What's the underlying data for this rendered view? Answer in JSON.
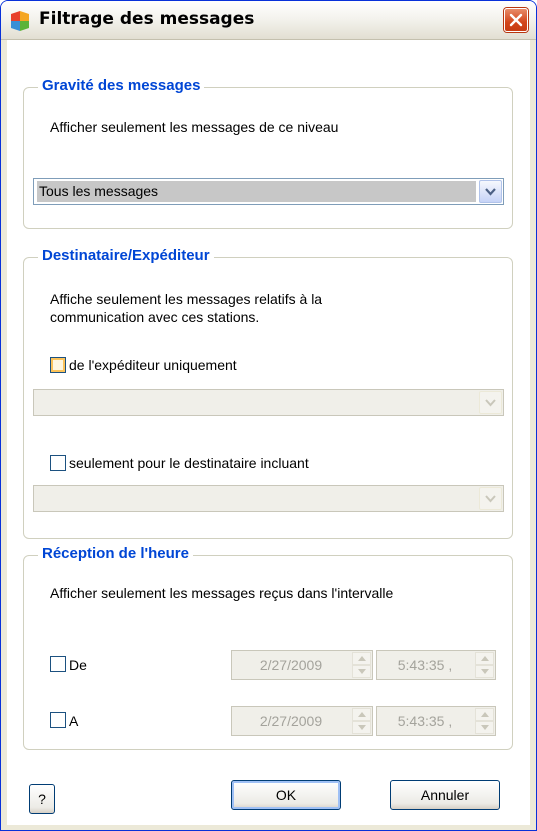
{
  "window": {
    "title": "Filtrage des messages",
    "accent": "#0046d5"
  },
  "severity": {
    "legend": "Gravité des messages",
    "description": "Afficher seulement les messages de ce niveau",
    "selected": "Tous les messages"
  },
  "recipient": {
    "legend": "Destinataire/Expéditeur",
    "description_line1": "Affiche seulement les messages relatifs à la",
    "description_line2": "communication avec ces stations.",
    "sender_label": "de l'expéditeur uniquement",
    "sender_value": "",
    "recipient_label": "seulement pour le destinataire incluant",
    "recipient_value": ""
  },
  "time": {
    "legend": "Réception de l'heure",
    "description": "Afficher seulement les messages reçus dans l'intervalle",
    "from_label": "De",
    "from_date": "2/27/2009",
    "from_time": "5:43:35 ,",
    "to_label": "A",
    "to_date": "2/27/2009",
    "to_time": "5:43:35 ,"
  },
  "buttons": {
    "help": "?",
    "ok": "OK",
    "cancel": "Annuler"
  }
}
